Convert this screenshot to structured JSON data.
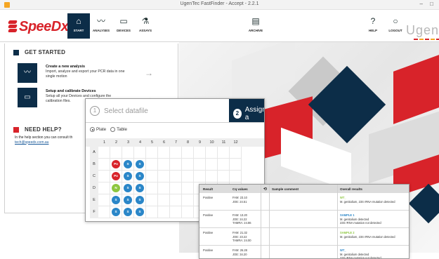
{
  "titlebar": {
    "title": "UgenTec FastFinder - Accept - 2.2.1",
    "controls": "– □"
  },
  "logo": {
    "text": "SpeeDx"
  },
  "nav": {
    "start": {
      "label": "START",
      "icon": "home-icon"
    },
    "analyses": {
      "label": "ANALYSES",
      "icon": "wave-icon"
    },
    "devices": {
      "label": "DEVICES",
      "icon": "device-icon"
    },
    "assays": {
      "label": "ASSAYS",
      "icon": "flask-icon"
    },
    "archive": {
      "label": "ARCHIVE",
      "icon": "archive-icon"
    },
    "help": {
      "label": "HELP",
      "icon": "question-icon"
    },
    "logout": {
      "label": "LOGOUT",
      "icon": "power-icon"
    }
  },
  "brand_right": "Ugen",
  "get_started": {
    "heading": "GET STARTED",
    "cards": [
      {
        "title": "Create a new analysis",
        "desc": "Import, analyze and export your PCR data in one single motion"
      },
      {
        "title": "Setup and calibrate Devices",
        "desc": "Setup all your Devices and configure the calibration files."
      }
    ]
  },
  "need_help": {
    "heading": "NEED HELP?",
    "text": "In the help section you can consult th",
    "email": "tech@speedx.com.au"
  },
  "plate": {
    "step1": {
      "num": "1",
      "label": "Select datafile"
    },
    "step2": {
      "num": "2",
      "label": "Assign a"
    },
    "radio_plate": "Plate",
    "radio_table": "Table",
    "columns": [
      "1",
      "2",
      "3",
      "4",
      "5",
      "6",
      "7",
      "8",
      "9",
      "10",
      "11",
      "12"
    ],
    "rows": [
      "A",
      "B",
      "C",
      "D",
      "E",
      "F"
    ],
    "wells": [
      {
        "row": 1,
        "col": 1,
        "label": "Po",
        "color": "#d8232a"
      },
      {
        "row": 1,
        "col": 2,
        "label": "S",
        "color": "#2a86c8"
      },
      {
        "row": 1,
        "col": 3,
        "label": "S",
        "color": "#2a86c8"
      },
      {
        "row": 2,
        "col": 1,
        "label": "Po",
        "color": "#d8232a"
      },
      {
        "row": 2,
        "col": 2,
        "label": "S",
        "color": "#2a86c8"
      },
      {
        "row": 2,
        "col": 3,
        "label": "S",
        "color": "#2a86c8"
      },
      {
        "row": 3,
        "col": 1,
        "label": "N",
        "color": "#8dc63f"
      },
      {
        "row": 3,
        "col": 2,
        "label": "S",
        "color": "#2a86c8"
      },
      {
        "row": 3,
        "col": 3,
        "label": "S",
        "color": "#2a86c8"
      },
      {
        "row": 4,
        "col": 1,
        "label": "S",
        "color": "#2a86c8"
      },
      {
        "row": 4,
        "col": 2,
        "label": "S",
        "color": "#2a86c8"
      },
      {
        "row": 4,
        "col": 3,
        "label": "S",
        "color": "#2a86c8"
      },
      {
        "row": 5,
        "col": 1,
        "label": "S",
        "color": "#2a86c8"
      },
      {
        "row": 5,
        "col": 2,
        "label": "S",
        "color": "#2a86c8"
      },
      {
        "row": 5,
        "col": 3,
        "label": "S",
        "color": "#2a86c8"
      }
    ]
  },
  "results": {
    "headers": {
      "result": "Result",
      "cq": "Cq values",
      "comment": "Sample comment",
      "overall": "Overall results"
    },
    "rows": [
      {
        "result": "Positive",
        "cq": [
          "FAM: 23.10",
          "JOE: 24.51"
        ],
        "overall_title": "WT_",
        "overall_color": "#8dc63f",
        "overall_lines": [
          "M. genitalium, 23S rRNA mutation detected"
        ]
      },
      {
        "result": "Positive",
        "cq": [
          "FAM: 13.20",
          "JOE: 24.22",
          "TAMRA: 24.86"
        ],
        "overall_title": "SAMPLE 1",
        "overall_color": "#2a86c8",
        "overall_lines": [
          "M. genitalium detected",
          "23S rRNA mutation not detected"
        ]
      },
      {
        "result": "Positive",
        "cq": [
          "FAM: 21.32",
          "JOE: 23.22",
          "TAMRA: 24.00"
        ],
        "overall_title": "SAMPLE 2",
        "overall_color": "#8dc63f",
        "overall_lines": [
          "M. genitalium, 23S rRNA mutation detected"
        ]
      },
      {
        "result": "Positive",
        "cq": [
          "FAM: 26.28",
          "JOE: 34.20"
        ],
        "overall_title": "WT_",
        "overall_color": "#2a86c8",
        "overall_lines": [
          "M. genitalium detected",
          "23S rRNA mutation not detected"
        ]
      }
    ]
  },
  "colors": {
    "navy": "#0c2d48",
    "red": "#d8232a",
    "green": "#8dc63f",
    "blue": "#2a86c8"
  }
}
